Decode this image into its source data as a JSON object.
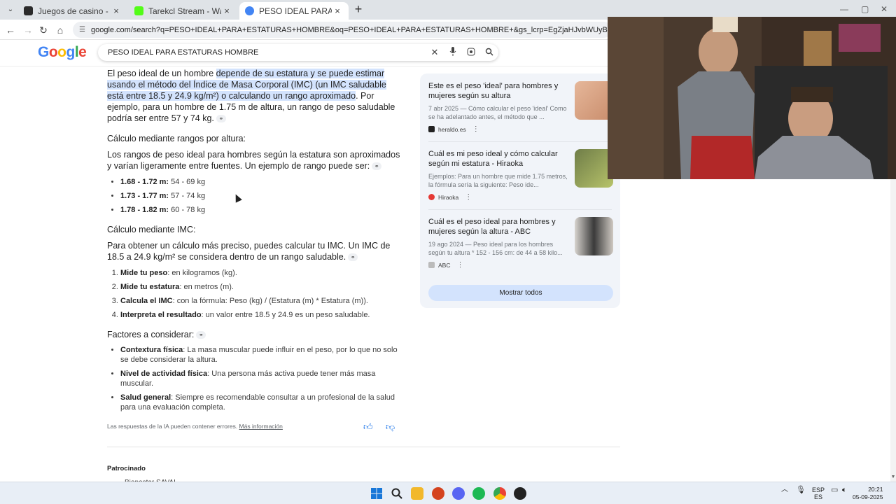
{
  "browser": {
    "tabs": [
      {
        "title": "Juegos de casino - Juegos de c",
        "color": "#2b2b2b"
      },
      {
        "title": "Tarekcl Stream - Watch Live on",
        "color": "#53fc18"
      },
      {
        "title": "PESO IDEAL PARA ESTATURAS H",
        "color": "#4285f4"
      }
    ],
    "url": "google.com/search?q=PESO+IDEAL+PARA+ESTATURAS+HOMBRE&oq=PESO+IDEAL+PARA+ESTATURAS+HOMBRE+&gs_lcrp=EgZjaHJvbWUyBggAEEUYOTIHCAEQIRigATIHCAIQIR"
  },
  "google": {
    "logo": "Google",
    "query": "PESO IDEAL PARA ESTATURAS HOMBRE"
  },
  "overview": {
    "intro_a": "El peso ideal de un hombre ",
    "intro_hl": "depende de su estatura y se puede estimar usando el método del Índice de Masa Corporal (IMC) (un IMC saludable está entre 18.5 y 24.9 kg/m²) o calculando un rango aproximado",
    "intro_b": ". Por ejemplo, para un hombre de 1.75 m de altura, un rango de peso saludable podría ser entre 57 y 74 kg.",
    "sec1": "Cálculo mediante rangos por altura:",
    "sec1_text": "Los rangos de peso ideal para hombres según la estatura son aproximados y varían ligeramente entre fuentes. Un ejemplo de rango puede ser:",
    "ranges": [
      {
        "k": "1.68 - 1.72 m:",
        "v": " 54 - 69 kg"
      },
      {
        "k": "1.73 - 1.77 m:",
        "v": " 57 - 74 kg"
      },
      {
        "k": "1.78 - 1.82 m:",
        "v": " 60 - 78 kg"
      }
    ],
    "sec2": "Cálculo mediante IMC:",
    "sec2_text": "Para obtener un cálculo más preciso, puedes calcular tu IMC. Un IMC de 18.5 a 24.9 kg/m² se considera dentro de un rango saludable.",
    "steps": [
      {
        "k": "Mide tu peso",
        "v": ": en kilogramos (kg)."
      },
      {
        "k": "Mide tu estatura",
        "v": ": en metros (m)."
      },
      {
        "k": "Calcula el IMC",
        "v": ": con la fórmula: Peso (kg) / (Estatura (m) * Estatura (m))."
      },
      {
        "k": "Interpreta el resultado",
        "v": ": un valor entre 18.5 y 24.9 es un peso saludable."
      }
    ],
    "sec3": "Factores a considerar:",
    "factors": [
      {
        "k": "Contextura física",
        "v": ": La masa muscular puede influir en el peso, por lo que no solo se debe considerar la altura."
      },
      {
        "k": "Nivel de actividad física",
        "v": ": Una persona más activa puede tener más masa muscular."
      },
      {
        "k": "Salud general",
        "v": ": Siempre es recomendable consultar a un profesional de la salud para una evaluación completa."
      }
    ],
    "disclaimer": "Las respuestas de la IA pueden contener errores. ",
    "more_info": "Más información"
  },
  "sources": [
    {
      "title": "Este es el peso 'ideal' para hombres y mujeres según su altura",
      "snippet": "7 abr 2025 — Cómo calcular el peso 'ideal' Como se ha adelantado antes, el método que ...",
      "site": "heraldo.es",
      "color": "#222222"
    },
    {
      "title": "Cuál es mi peso ideal y cómo calcular según mi estatura - Hiraoka",
      "snippet": "Ejemplos: Para un hombre que mide 1.75 metros, la fórmula sería la siguiente: Peso ide...",
      "site": "Hiraoka",
      "color": "#e53935"
    },
    {
      "title": "Cuál es el peso ideal para hombres y mujeres según la altura - ABC",
      "snippet": "19 ago 2024 — Peso ideal para los hombres según tu altura * 152 - 156 cm: de 44 a 58 kilo...",
      "site": "ABC",
      "color": "#9e9e9e"
    }
  ],
  "show_all": "Mostrar todos",
  "sponsored": "Patrocinado",
  "sponsored_item": "Bienestar SAVAL",
  "taskbar": {
    "lang_top": "ESP",
    "lang_bottom": "ES",
    "time": "20:21",
    "date": "05-09-2025"
  }
}
